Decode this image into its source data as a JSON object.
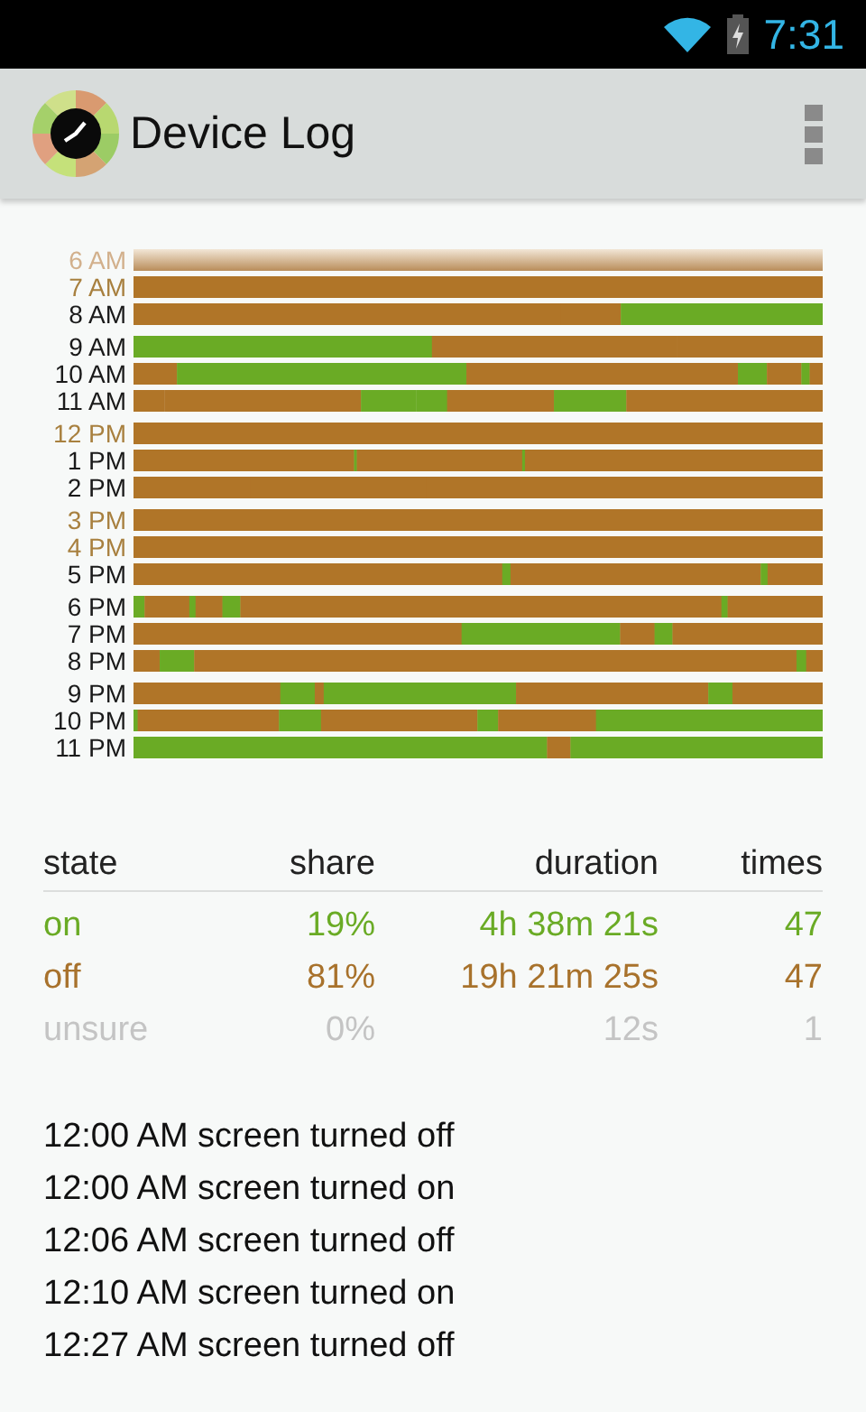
{
  "status_bar": {
    "time": "7:31"
  },
  "action_bar": {
    "title": "Device Log"
  },
  "hour_groups": [
    {
      "hours": [
        {
          "label": "6 AM",
          "kind": "faded"
        },
        {
          "label": "7 AM",
          "kind": "quiet"
        },
        {
          "label": "8 AM",
          "kind": "active"
        }
      ]
    },
    {
      "hours": [
        {
          "label": "9 AM",
          "kind": "active"
        },
        {
          "label": "10 AM",
          "kind": "active"
        },
        {
          "label": "11 AM",
          "kind": "active"
        }
      ]
    },
    {
      "hours": [
        {
          "label": "12 PM",
          "kind": "quiet"
        },
        {
          "label": "1 PM",
          "kind": "active"
        },
        {
          "label": "2 PM",
          "kind": "active"
        }
      ]
    },
    {
      "hours": [
        {
          "label": "3 PM",
          "kind": "quiet"
        },
        {
          "label": "4 PM",
          "kind": "quiet"
        },
        {
          "label": "5 PM",
          "kind": "active"
        }
      ]
    },
    {
      "hours": [
        {
          "label": "6 PM",
          "kind": "active"
        },
        {
          "label": "7 PM",
          "kind": "active"
        },
        {
          "label": "8 PM",
          "kind": "active"
        }
      ]
    },
    {
      "hours": [
        {
          "label": "9 PM",
          "kind": "active"
        },
        {
          "label": "10 PM",
          "kind": "active"
        },
        {
          "label": "11 PM",
          "kind": "active"
        }
      ]
    }
  ],
  "stats_table": {
    "columns": [
      "state",
      "share",
      "duration",
      "times"
    ],
    "rows": [
      {
        "kind": "on",
        "cells": [
          "on",
          "19%",
          "4h 38m 21s",
          "47"
        ]
      },
      {
        "kind": "off",
        "cells": [
          "off",
          "81%",
          "19h 21m 25s",
          "47"
        ]
      },
      {
        "kind": "unsure",
        "cells": [
          "unsure",
          "0%",
          "12s",
          "1"
        ]
      }
    ]
  },
  "event_log": [
    "12:00 AM screen turned off",
    "12:00 AM screen turned on",
    "12:06 AM screen turned off",
    "12:10 AM screen turned on",
    "12:27 AM screen turned off"
  ]
}
